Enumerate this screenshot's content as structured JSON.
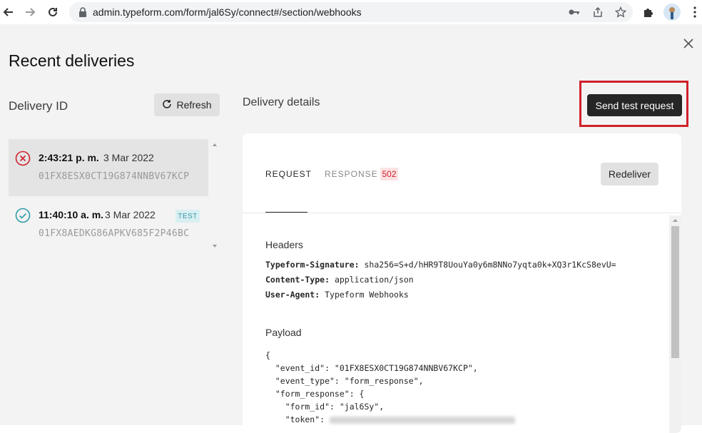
{
  "browser": {
    "url": "admin.typeform.com/form/jal6Sy/connect#/section/webhooks",
    "icons": [
      "back-arrow-icon",
      "forward-arrow-icon",
      "reload-icon",
      "lock-icon",
      "key-icon",
      "share-icon",
      "star-icon",
      "puzzle-icon",
      "kebab-menu-icon"
    ]
  },
  "page": {
    "title": "Recent deliveries",
    "delivery_id_label": "Delivery ID",
    "refresh_label": "Refresh",
    "delivery_details_label": "Delivery details",
    "send_test_label": "Send test request",
    "highlight_color": "#d0202c"
  },
  "deliveries": [
    {
      "time": "2:43:21 p. m.",
      "date": "3 Mar 2022",
      "id": "01FX8ESX0CT19G874NNBV67KCP",
      "status": "failed",
      "status_icon": "error-circle-icon",
      "badge": ""
    },
    {
      "time": "11:40:10 a. m.",
      "date": "3 Mar 2022",
      "id": "01FX8AEDKG86APKV685F2P46BC",
      "status": "success",
      "status_icon": "check-circle-icon",
      "badge": "TEST"
    }
  ],
  "details": {
    "tab_request": "REQUEST",
    "tab_response": "RESPONSE",
    "response_code": "502",
    "redeliver_label": "Redeliver",
    "headers_title": "Headers",
    "headers": [
      {
        "key": "Typeform-Signature:",
        "value": "sha256=S+d/hHR9T8UouYa0y6m8NNo7yqta0k+XQ3r1KcS8evU="
      },
      {
        "key": "Content-Type:",
        "value": "application/json"
      },
      {
        "key": "User-Agent:",
        "value": "Typeform Webhooks"
      }
    ],
    "payload_title": "Payload",
    "payload_lines": [
      "{",
      "  \"event_id\": \"01FX8ESX0CT19G874NNBV67KCP\",",
      "  \"event_type\": \"form_response\",",
      "  \"form_response\": {",
      "    \"form_id\": \"jal6Sy\",",
      "    \"token\": "
    ]
  }
}
